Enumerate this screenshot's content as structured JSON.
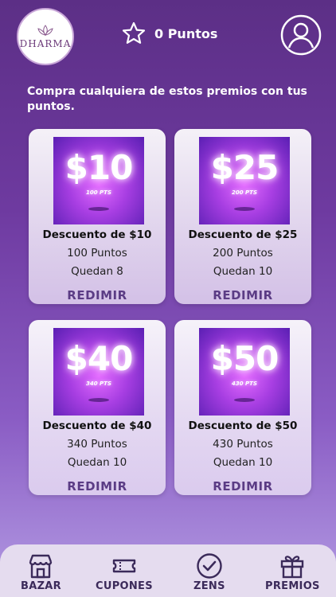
{
  "header": {
    "logo_text": "DHARMA",
    "points_label": "0 Puntos"
  },
  "intro": "Compra cualquiera de estos premios con tus puntos.",
  "cards": [
    {
      "image_big": "$10",
      "image_small": "100 PTS",
      "title": "Descuento de $10",
      "cost": "100 Puntos",
      "remaining": "Quedan 8",
      "action": "REDIMIR"
    },
    {
      "image_big": "$25",
      "image_small": "200 PTS",
      "title": "Descuento de $25",
      "cost": "200 Puntos",
      "remaining": "Quedan 10",
      "action": "REDIMIR"
    },
    {
      "image_big": "$40",
      "image_small": "340 PTS",
      "title": "Descuento de $40",
      "cost": "340 Puntos",
      "remaining": "Quedan 10",
      "action": "REDIMIR"
    },
    {
      "image_big": "$50",
      "image_small": "430 PTS",
      "title": "Descuento de $50",
      "cost": "430 Puntos",
      "remaining": "Quedan 10",
      "action": "REDIMIR"
    }
  ],
  "nav": [
    {
      "label": "BAZAR",
      "icon": "store-icon"
    },
    {
      "label": "CUPONES",
      "icon": "ticket-icon"
    },
    {
      "label": "ZENS",
      "icon": "check-circle-icon"
    },
    {
      "label": "PREMIOS",
      "icon": "gift-icon"
    }
  ],
  "colors": {
    "accent_text": "#5b3c85",
    "nav_bg": "#e5dcef"
  }
}
